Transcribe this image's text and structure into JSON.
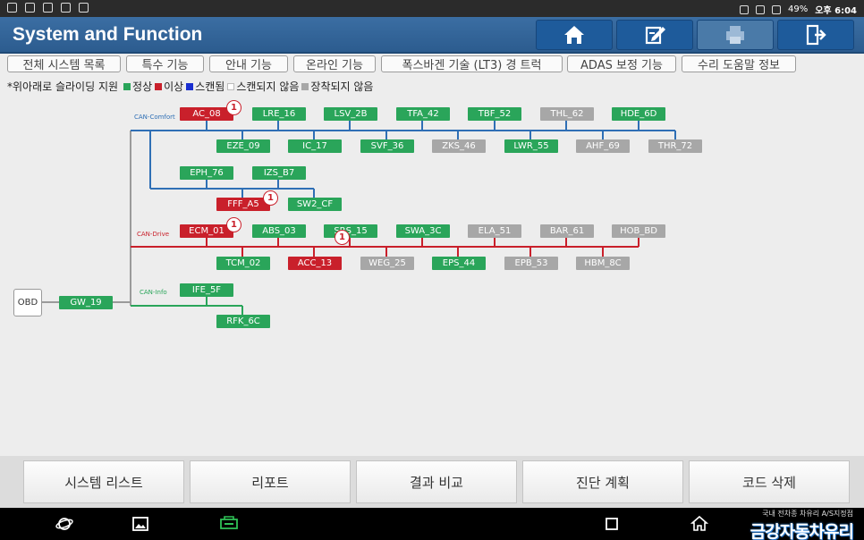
{
  "status": {
    "battery": "49%",
    "time": "오후 6:04"
  },
  "header": {
    "title": "System and Function",
    "buttons": [
      {
        "name": "home-button",
        "icon": "home-icon"
      },
      {
        "name": "report-edit-button",
        "icon": "edit-icon"
      },
      {
        "name": "print-button",
        "icon": "printer-icon"
      },
      {
        "name": "exit-button",
        "icon": "exit-icon"
      }
    ]
  },
  "tabs": [
    {
      "label": "전체 시스템 목록"
    },
    {
      "label": "특수 기능"
    },
    {
      "label": "안내 기능"
    },
    {
      "label": "온라인 기능"
    },
    {
      "label": "폭스바겐 기술 (LT3) 경 트럭"
    },
    {
      "label": "ADAS 보정 기능"
    },
    {
      "label": "수리 도움말 정보"
    }
  ],
  "legend": {
    "prefix": "*위아래로 슬라이딩 지원",
    "items": [
      {
        "label": "정상",
        "color": "#2aa55a"
      },
      {
        "label": "이상",
        "color": "#c9202b"
      },
      {
        "label": "스캔됨",
        "color": "#1a2fd0"
      },
      {
        "label": "스캔되지 않음",
        "color": "#ffffff"
      },
      {
        "label": "장착되지 않음",
        "color": "#a7a7a7"
      }
    ]
  },
  "diagram": {
    "obd": "OBD",
    "gateway": "GW_19",
    "buses": [
      {
        "label": "CAN-Comfort",
        "color": "#2f6fb5"
      },
      {
        "label": "CAN-Drive",
        "color": "#c9202b"
      },
      {
        "label": "CAN-Info",
        "color": "#2aa55a"
      }
    ],
    "modules": [
      {
        "label": "AC_08",
        "status": "err",
        "badge": "1"
      },
      {
        "label": "LRE_16",
        "status": "ok"
      },
      {
        "label": "LSV_2B",
        "status": "ok"
      },
      {
        "label": "TFA_42",
        "status": "ok"
      },
      {
        "label": "TBF_52",
        "status": "ok"
      },
      {
        "label": "THL_62",
        "status": "na"
      },
      {
        "label": "HDE_6D",
        "status": "ok"
      },
      {
        "label": "EZE_09",
        "status": "ok"
      },
      {
        "label": "IC_17",
        "status": "ok"
      },
      {
        "label": "SVF_36",
        "status": "ok"
      },
      {
        "label": "ZKS_46",
        "status": "na"
      },
      {
        "label": "LWR_55",
        "status": "ok"
      },
      {
        "label": "AHF_69",
        "status": "na"
      },
      {
        "label": "THR_72",
        "status": "na"
      },
      {
        "label": "EPH_76",
        "status": "ok"
      },
      {
        "label": "IZS_B7",
        "status": "ok"
      },
      {
        "label": "FFF_A5",
        "status": "err",
        "badge": "1"
      },
      {
        "label": "SW2_CF",
        "status": "ok"
      },
      {
        "label": "ECM_01",
        "status": "err",
        "badge": "1"
      },
      {
        "label": "ABS_03",
        "status": "ok"
      },
      {
        "label": "SRS_15",
        "status": "ok"
      },
      {
        "label": "SWA_3C",
        "status": "ok"
      },
      {
        "label": "ELA_51",
        "status": "na"
      },
      {
        "label": "BAR_61",
        "status": "na"
      },
      {
        "label": "HOB_BD",
        "status": "na"
      },
      {
        "label": "TCM_02",
        "status": "ok"
      },
      {
        "label": "ACC_13",
        "status": "err",
        "badge": "1"
      },
      {
        "label": "WEG_25",
        "status": "na"
      },
      {
        "label": "EPS_44",
        "status": "ok"
      },
      {
        "label": "EPB_53",
        "status": "na"
      },
      {
        "label": "HBM_8C",
        "status": "na"
      },
      {
        "label": "IFE_5F",
        "status": "ok"
      },
      {
        "label": "RFK_6C",
        "status": "ok"
      }
    ]
  },
  "bottom": [
    {
      "label": "시스템 리스트"
    },
    {
      "label": "리포트"
    },
    {
      "label": "결과 비교"
    },
    {
      "label": "진단 계획"
    },
    {
      "label": "코드 삭제"
    }
  ],
  "watermark": {
    "small": "국내 전차종 차유리 A/S지정점",
    "big": "금강자동차유리"
  }
}
